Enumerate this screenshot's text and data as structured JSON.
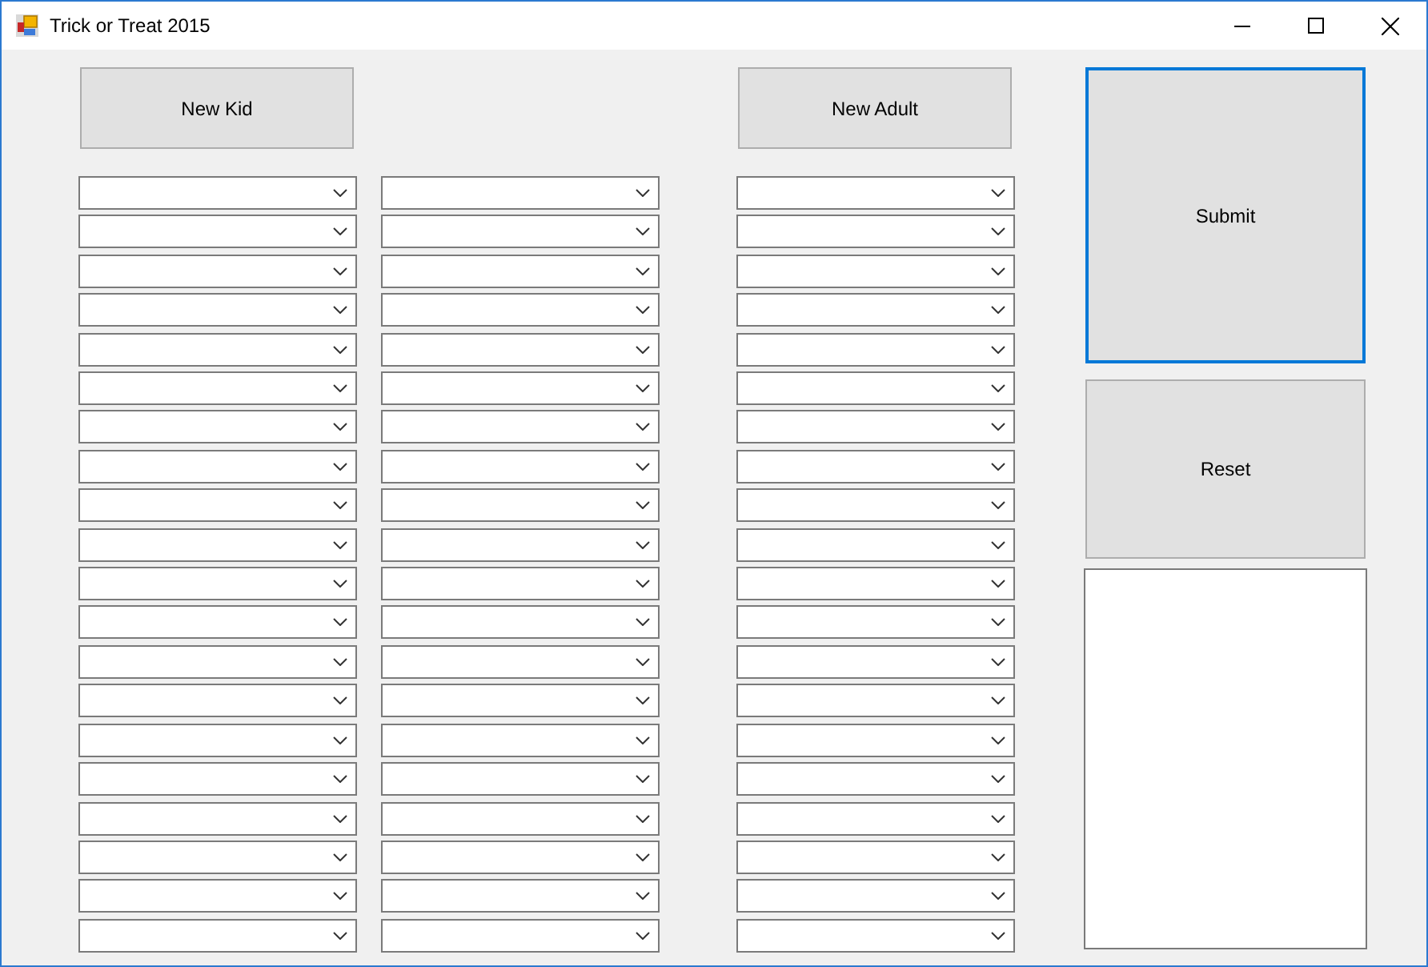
{
  "window": {
    "title": "Trick or Treat 2015"
  },
  "top_buttons": [
    {
      "label": "New Kid",
      "focused": false
    },
    {
      "label": "New Adult",
      "focused": false
    }
  ],
  "dropdown_columns": [
    [
      {
        "kind": "combobox"
      },
      {
        "kind": "combobox"
      },
      {
        "kind": "combobox"
      },
      {
        "kind": "combobox"
      },
      {
        "kind": "combobox"
      },
      {
        "kind": "combobox"
      },
      {
        "kind": "combobox"
      },
      {
        "kind": "combobox"
      },
      {
        "kind": "combobox"
      },
      {
        "kind": "combobox"
      },
      {
        "kind": "combobox"
      },
      {
        "kind": "combobox"
      },
      {
        "kind": "combobox"
      },
      {
        "kind": "combobox"
      },
      {
        "kind": "combobox"
      },
      {
        "kind": "combobox"
      },
      {
        "kind": "combobox"
      },
      {
        "kind": "combobox"
      },
      {
        "kind": "combobox"
      },
      {
        "kind": "combobox"
      }
    ],
    [
      {
        "kind": "combobox"
      },
      {
        "kind": "combobox"
      },
      {
        "kind": "combobox"
      },
      {
        "kind": "combobox"
      },
      {
        "kind": "combobox"
      },
      {
        "kind": "combobox"
      },
      {
        "kind": "combobox"
      },
      {
        "kind": "combobox"
      },
      {
        "kind": "combobox"
      },
      {
        "kind": "combobox"
      },
      {
        "kind": "combobox"
      },
      {
        "kind": "combobox"
      },
      {
        "kind": "combobox"
      },
      {
        "kind": "combobox"
      },
      {
        "kind": "combobox"
      },
      {
        "kind": "combobox"
      },
      {
        "kind": "combobox"
      },
      {
        "kind": "combobox"
      },
      {
        "kind": "combobox"
      },
      {
        "kind": "combobox"
      }
    ],
    [
      {
        "kind": "combobox"
      },
      {
        "kind": "combobox"
      },
      {
        "kind": "combobox"
      },
      {
        "kind": "combobox"
      },
      {
        "kind": "combobox"
      },
      {
        "kind": "combobox"
      },
      {
        "kind": "combobox"
      },
      {
        "kind": "combobox"
      },
      {
        "kind": "combobox"
      },
      {
        "kind": "combobox"
      },
      {
        "kind": "combobox"
      },
      {
        "kind": "combobox"
      },
      {
        "kind": "combobox"
      },
      {
        "kind": "combobox"
      },
      {
        "kind": "combobox"
      },
      {
        "kind": "combobox"
      },
      {
        "kind": "combobox"
      },
      {
        "kind": "combobox"
      },
      {
        "kind": "combobox"
      },
      {
        "kind": "combobox"
      }
    ]
  ],
  "side_buttons": [
    {
      "label": "Submit",
      "focused": true
    },
    {
      "label": "Reset",
      "focused": false
    }
  ],
  "output_box": {
    "kind": "textbox"
  }
}
